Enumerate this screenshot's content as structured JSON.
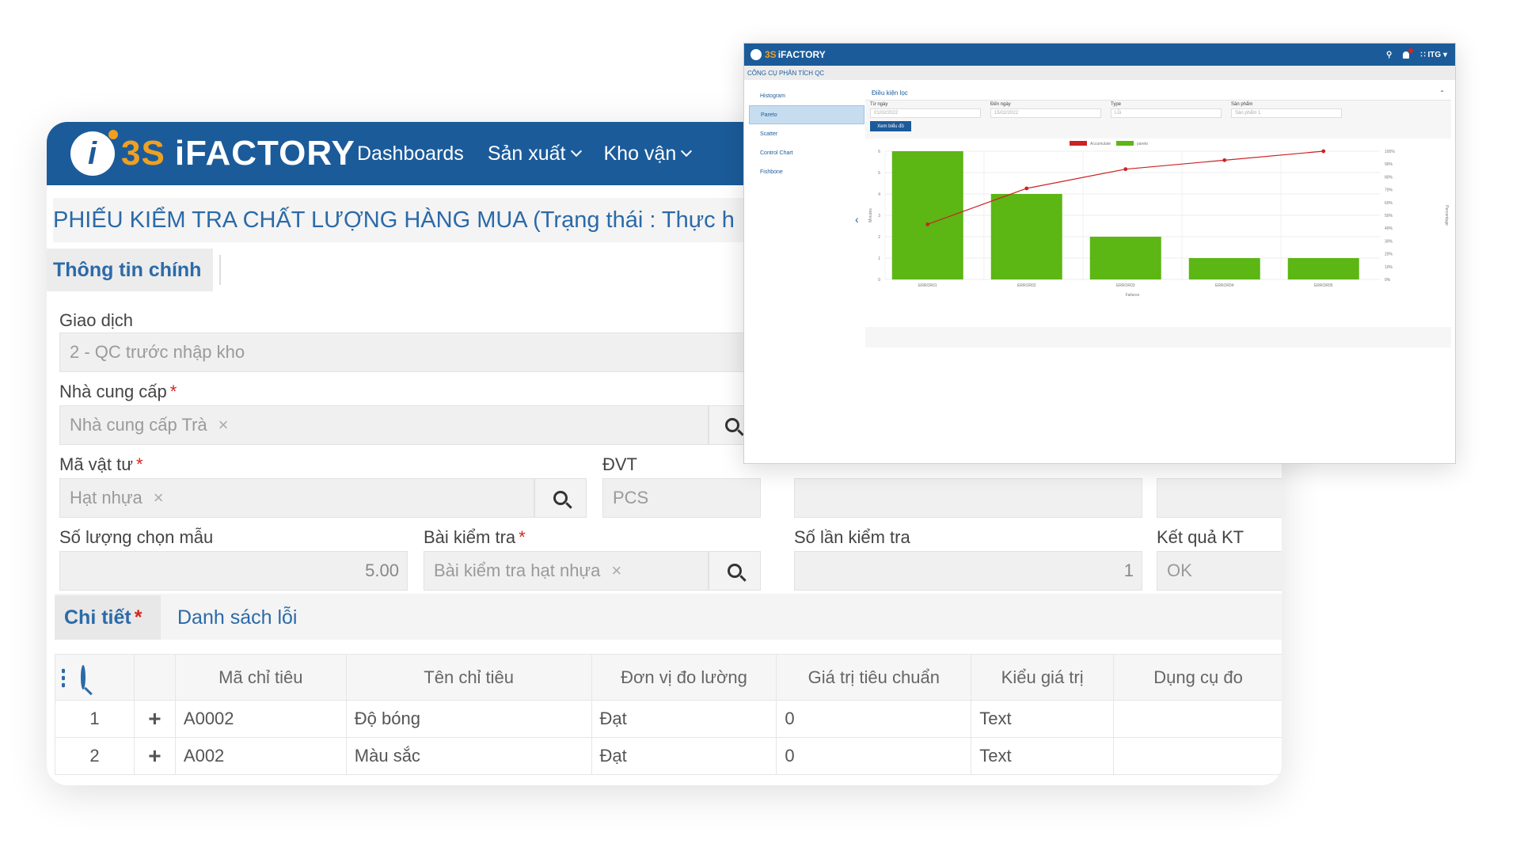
{
  "main_app": {
    "logo_badge": "i",
    "logo_brand": "3S",
    "logo_name": "iFACTORY",
    "nav": [
      "Dashboards",
      "Sản xuất",
      "Kho vận"
    ],
    "page_title": "PHIẾU KIỂM TRA CHẤT LƯỢNG HÀNG MUA (Trạng thái : Thực h",
    "main_tab": "Thông tin chính",
    "fields": {
      "giao_dich_label": "Giao dịch",
      "giao_dich_value": "2 - QC trước nhập kho",
      "nha_cung_cap_label": "Nhà cung cấp",
      "nha_cung_cap_value": "Nhà cung cấp Trà",
      "ma_vat_tu_label": "Mã vật tư",
      "ma_vat_tu_value": "Hạt nhựa",
      "dvt_label": "ĐVT",
      "dvt_value": "PCS",
      "so_luong_label": "Số lượng chọn mẫu",
      "so_luong_value": "5.00",
      "bai_kiem_tra_label": "Bài kiểm tra",
      "bai_kiem_tra_value": "Bài kiểm tra hạt nhựa",
      "so_lan_label": "Số lần kiểm tra",
      "so_lan_value": "1",
      "ket_qua_label": "Kết quả KT",
      "ket_qua_value": "OK"
    },
    "required_mark": "*",
    "remove_mark": "×",
    "detail_tabs": {
      "chi_tiet": "Chi tiết",
      "danh_sach_loi": "Danh sách lỗi"
    },
    "table": {
      "headers": [
        "Mã chỉ tiêu",
        "Tên chỉ tiêu",
        "Đơn vị đo lường",
        "Giá trị tiêu chuẩn",
        "Kiểu giá trị",
        "Dụng cụ đo"
      ],
      "rows": [
        {
          "no": "1",
          "add": "+",
          "code": "A0002",
          "name": "Độ bóng",
          "unit": "Đạt",
          "std": "0",
          "type": "Text",
          "tool": ""
        },
        {
          "no": "2",
          "add": "+",
          "code": "A002",
          "name": "Màu sắc",
          "unit": "Đạt",
          "std": "0",
          "type": "Text",
          "tool": ""
        }
      ]
    }
  },
  "qc_window": {
    "logo_brand": "3S",
    "logo_name": "iFACTORY",
    "user": "ITG",
    "breadcrumb": "CÔNG CỤ PHÂN TÍCH QC",
    "sidebar": [
      "Histogram",
      "Pareto",
      "Scatter",
      "Control Chart",
      "Fishbone"
    ],
    "active_item": "Pareto",
    "panel_title": "Điều kiện lọc",
    "filters": {
      "tu_ngay_label": "Từ ngày",
      "tu_ngay_value": "01/02/2022",
      "den_ngay_label": "Đến ngày",
      "den_ngay_value": "15/02/2022",
      "type_label": "Type",
      "type_value": "Lỗi",
      "san_pham_label": "Sản phẩm",
      "san_pham_value": "Sản phẩm 1"
    },
    "view_button": "Xem biểu đồ"
  },
  "chart_data": {
    "type": "bar",
    "categories": [
      "ERROR01",
      "ERROR02",
      "ERROR03",
      "ERROR04",
      "ERROR05"
    ],
    "series": [
      {
        "name": "pareto",
        "type": "bar",
        "values": [
          6,
          4,
          2,
          1,
          1
        ],
        "color": "#5cb614"
      },
      {
        "name": "Accumulate",
        "type": "line",
        "values": [
          0.43,
          0.71,
          0.86,
          0.93,
          1.0
        ],
        "color": "#cc2222"
      }
    ],
    "xlabel": "Failures",
    "ylabel": "Minutes",
    "y2label": "Percentage",
    "ylim": [
      0,
      6
    ],
    "y2lim": [
      0,
      1
    ],
    "yticks": [
      "0",
      "1",
      "2",
      "3",
      "4",
      "5",
      "6"
    ],
    "y2ticks": [
      "0%",
      "10%",
      "20%",
      "30%",
      "40%",
      "50%",
      "60%",
      "70%",
      "80%",
      "90%",
      "100%"
    ],
    "legend": "top-center",
    "grid": true
  }
}
